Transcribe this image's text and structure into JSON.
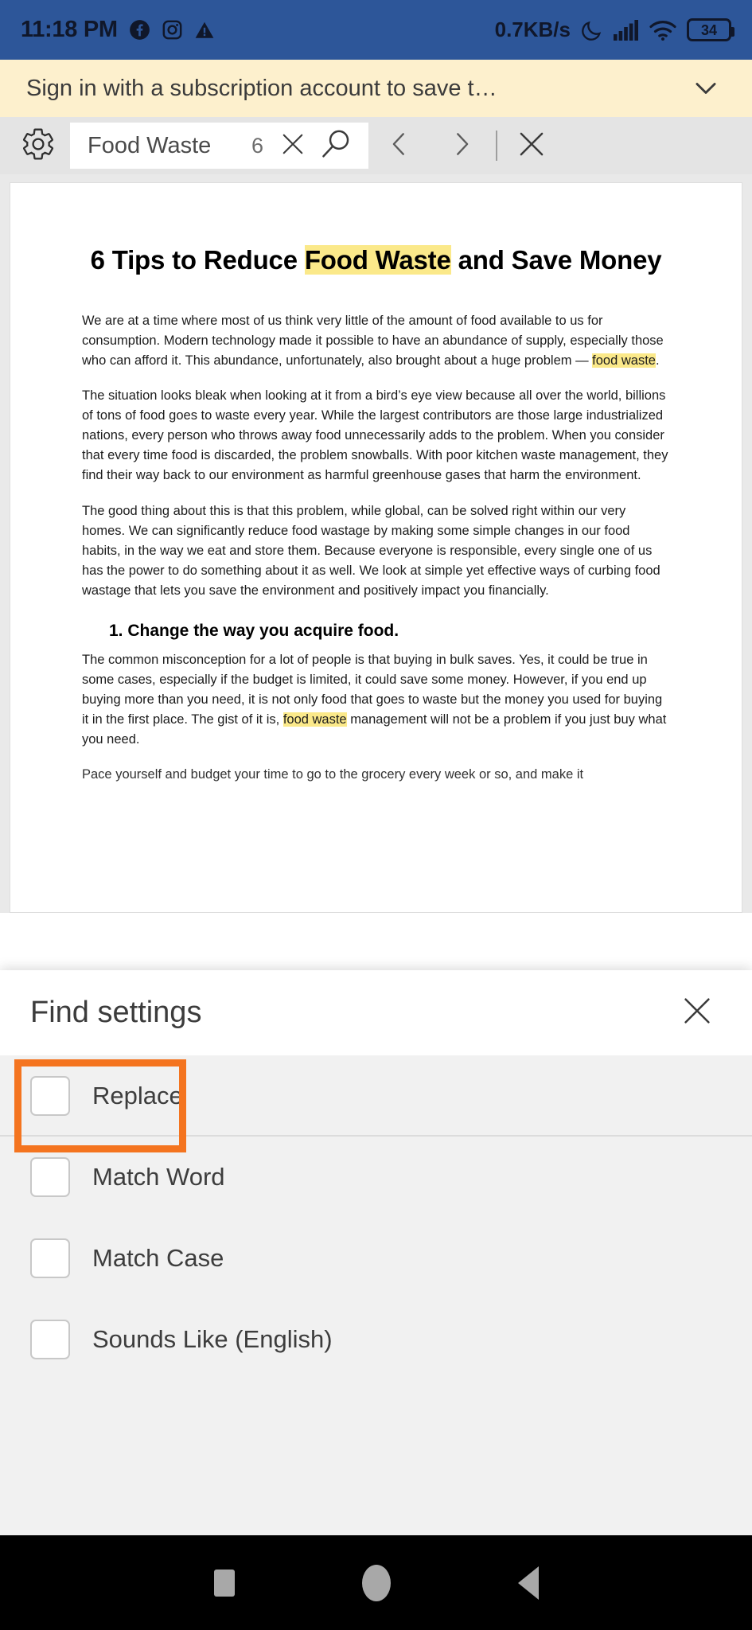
{
  "status_bar": {
    "time": "11:18 PM",
    "icons_left": [
      "facebook-icon",
      "instagram-icon",
      "warning-icon"
    ],
    "network_speed": "0.7KB/s",
    "icons_right": [
      "moon-icon",
      "signal-icon",
      "wifi-icon",
      "battery-icon"
    ],
    "battery_level": "34",
    "background_color": "#2d5699"
  },
  "signin_banner": {
    "text": "Sign in with a subscription account to save t…",
    "background_color": "#fdf0cd",
    "expand_icon": "chevron-down-icon"
  },
  "find_toolbar": {
    "settings_icon": "gear-icon",
    "query": "Food Waste",
    "match_count": "6",
    "clear_icon": "close-icon",
    "search_icon": "magnifier-icon",
    "prev_icon": "chevron-left-icon",
    "next_icon": "chevron-right-icon",
    "close_icon": "close-icon",
    "background_color": "#e4e4e4"
  },
  "document": {
    "title_part1": "6 Tips to Reduce ",
    "title_highlight": "Food Waste",
    "title_part2": " and Save Money",
    "paragraphs": [
      {
        "pre": "We are at a time where most of us think very little of the amount of food available to us for consumption. Modern technology made it possible to have an abundance of supply, especially those who can afford it. This abundance, unfortunately, also brought about a huge problem — ",
        "highlight": "food waste",
        "post": "."
      },
      {
        "pre": "The situation looks bleak when looking at it from a bird’s eye view because all over the world, billions of tons of food goes to waste every year. While the largest contributors are those large industrialized nations, every person who throws away food unnecessarily adds to the problem. When you consider that every time food is discarded, the problem snowballs. With poor kitchen waste management, they find their way back to our environment as harmful greenhouse gases that harm the environment.",
        "highlight": "",
        "post": ""
      },
      {
        "pre": "The good thing about this is that this problem, while global, can be solved right within our very homes. We can significantly reduce food wastage by making some simple changes in our food habits, in the way we eat and store them. Because everyone is responsible, every single one of us has the power to do something about it as well. We look at simple yet effective ways of curbing food wastage that lets you save the environment and positively impact you financially.",
        "highlight": "",
        "post": ""
      }
    ],
    "heading": "1. Change the way you acquire food.",
    "paragraph_after_heading": {
      "pre": "The common misconception for a lot of people is that buying in bulk saves. Yes, it could be true in some cases, especially if the budget is limited, it could save some money. However, if you end up buying more than you need, it is not only food that goes to waste but the money you used for buying it in the first place. The gist of it is, ",
      "highlight": "food waste",
      "post": " management will not be a problem if you just buy what you need."
    },
    "cut_off_line": "Pace yourself and budget your time to go to the grocery every week or so, and make it",
    "highlight_color": "#fbe98a"
  },
  "find_settings": {
    "title": "Find settings",
    "close_icon": "close-icon",
    "options": [
      {
        "label": "Replace",
        "checked": false,
        "highlighted": true
      },
      {
        "label": "Match Word",
        "checked": false,
        "highlighted": false
      },
      {
        "label": "Match Case",
        "checked": false,
        "highlighted": false
      },
      {
        "label": "Sounds Like (English)",
        "checked": false,
        "highlighted": false
      }
    ],
    "highlight_color": "#f4741f",
    "background_color": "#f1f1f1"
  },
  "android_nav": {
    "recents_icon": "square-icon",
    "home_icon": "circle-icon",
    "back_icon": "triangle-back-icon",
    "background_color": "#000000"
  }
}
